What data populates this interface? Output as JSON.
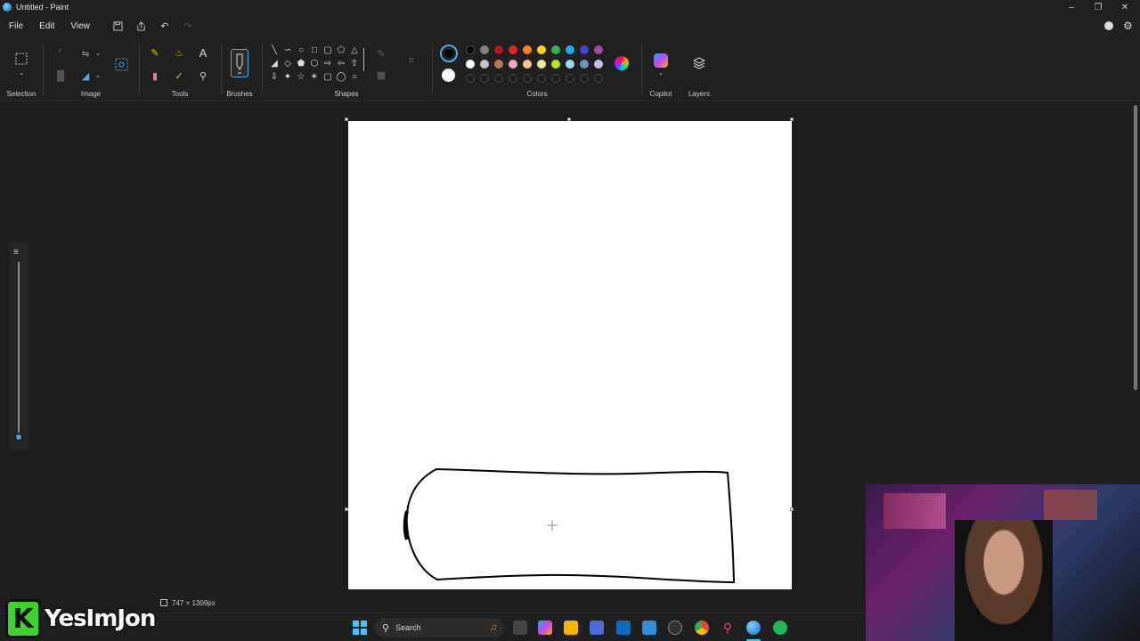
{
  "window": {
    "title": "Untitled - Paint"
  },
  "menu": {
    "file": "File",
    "edit": "Edit",
    "view": "View"
  },
  "ribbon": {
    "selection_label": "Selection",
    "image_label": "Image",
    "tools_label": "Tools",
    "brushes_label": "Brushes",
    "shapes_label": "Shapes",
    "colors_label": "Colors",
    "copilot_label": "Copilot",
    "layers_label": "Layers"
  },
  "colors": {
    "primary": "#000000",
    "secondary": "#ffffff",
    "row1": [
      "#000000",
      "#7f7f7f",
      "#b7191c",
      "#e3242b",
      "#f7861f",
      "#f8d21d",
      "#2bb24c",
      "#1ea7e1",
      "#3f48cc",
      "#a349a4"
    ],
    "row2": [
      "#ffffff",
      "#c3c3c3",
      "#b97a57",
      "#f5a3c7",
      "#f9c98a",
      "#f6e7a1",
      "#b5e61d",
      "#99d9ea",
      "#7092be",
      "#c8bfe7"
    ]
  },
  "status": {
    "canvas_size": "747 × 1309px"
  },
  "taskbar": {
    "search_placeholder": "Search"
  },
  "overlay": {
    "logo_letter": "K",
    "channel_name": "YesImJon"
  }
}
